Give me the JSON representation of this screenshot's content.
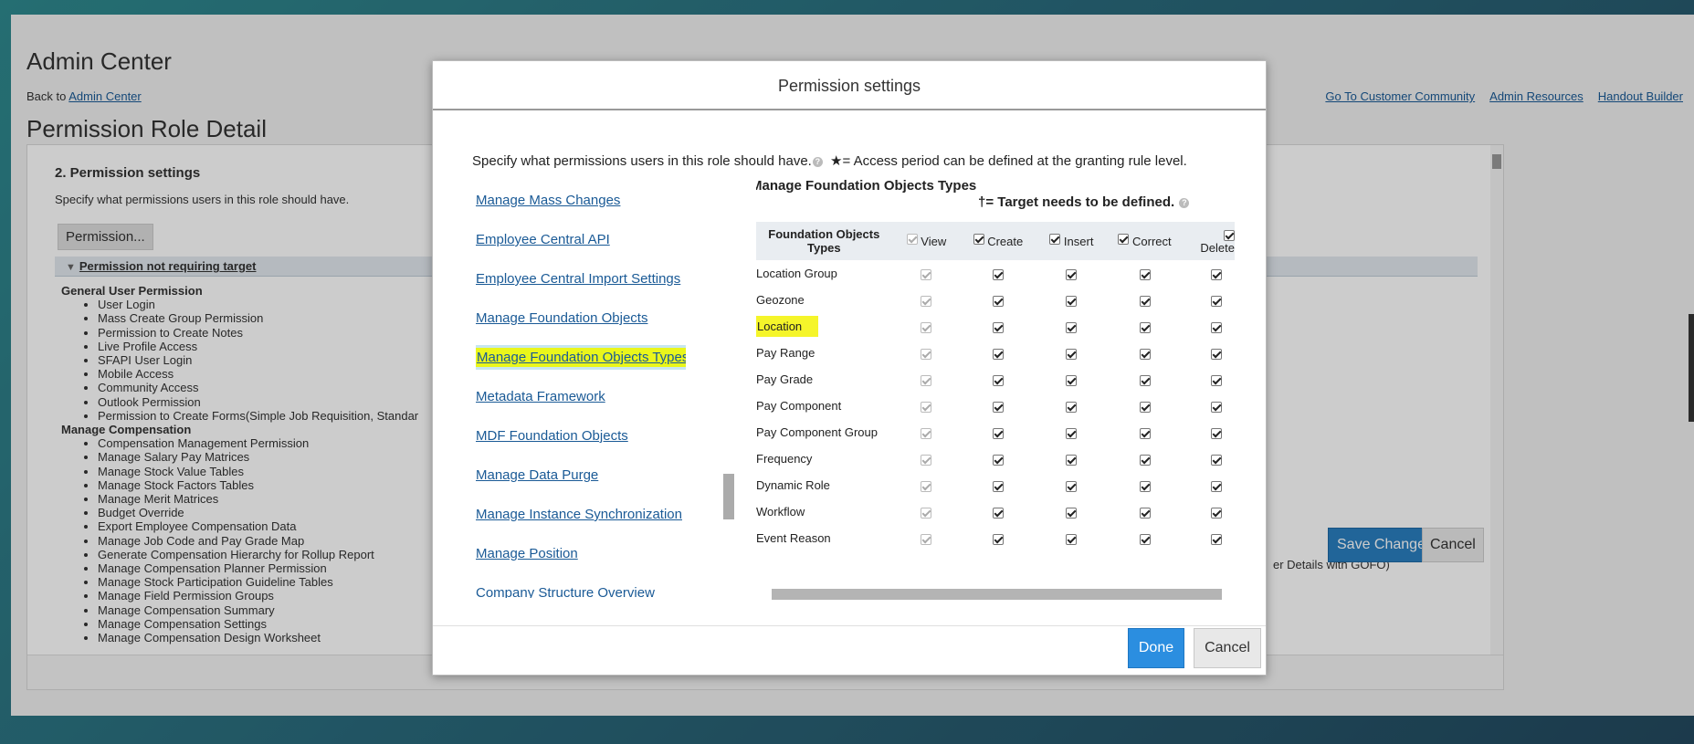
{
  "app": {
    "title": "Admin Center",
    "back_prefix": "Back to",
    "back_link": "Admin Center",
    "page_title": "Permission Role Detail"
  },
  "top_links": [
    "Go To Customer Community",
    "Admin Resources",
    "Handout Builder"
  ],
  "panel": {
    "heading": "2. Permission settings",
    "description": "Specify what permissions users in this role should have.",
    "permission_button": "Permission...",
    "group_title": "Permission not requiring target",
    "sections": [
      {
        "title": "General User Permission",
        "items": [
          "User Login",
          "Mass Create Group Permission",
          "Permission to Create Notes",
          "Live Profile Access",
          "SFAPI User Login",
          "Mobile Access",
          "Community Access",
          "Outlook Permission",
          "Permission to Create Forms(Simple Job Requisition, Standar"
        ]
      },
      {
        "title": "Manage Compensation",
        "items": [
          "Compensation Management Permission",
          "Manage Salary Pay Matrices",
          "Manage Stock Value Tables",
          "Manage Stock Factors Tables",
          "Manage Merit Matrices",
          "Budget Override",
          "Export Employee Compensation Data",
          "Manage Job Code and Pay Grade Map",
          "Generate Compensation Hierarchy for Rollup Report",
          "Manage Compensation Planner Permission",
          "Manage Stock Participation Guideline Tables",
          "Manage Field Permission Groups",
          "Manage Compensation Summary",
          "Manage Compensation Settings",
          "Manage Compensation Design Worksheet"
        ]
      }
    ],
    "right_tail": "er Details with GOFO)",
    "save_label": "Save Changes",
    "cancel_label": "Cancel"
  },
  "modal": {
    "title": "Permission settings",
    "intro": "Specify what permissions users in this role should have.",
    "intro_note": "★= Access period can be defined at the granting rule level.",
    "categories": [
      "Manage Mass Changes",
      "Employee Central API",
      "Employee Central Import Settings",
      "Manage Foundation Objects",
      "Manage Foundation Objects Types",
      "Metadata Framework",
      "MDF Foundation Objects",
      "Manage Data Purge",
      "Manage Instance Synchronization",
      "Manage Position",
      "Company Structure Overview"
    ],
    "selected_category": "Manage Foundation Objects Types",
    "section_title": "Manage Foundation Objects Types",
    "target_note": "†= Target needs to be defined.",
    "table": {
      "first_header": "Foundation Objects Types",
      "columns": [
        "View",
        "Create",
        "Insert",
        "Correct",
        "Delete"
      ],
      "rows": [
        "Location Group",
        "Geozone",
        "Location",
        "Pay Range",
        "Pay Grade",
        "Pay Component",
        "Pay Component Group",
        "Frequency",
        "Dynamic Role",
        "Workflow",
        "Event Reason"
      ],
      "highlighted_row": "Location"
    },
    "done_label": "Done",
    "cancel_label": "Cancel"
  },
  "colors": {
    "accent": "#2b8ee0",
    "link": "#1a5a96",
    "highlight": "#eaf61b"
  }
}
